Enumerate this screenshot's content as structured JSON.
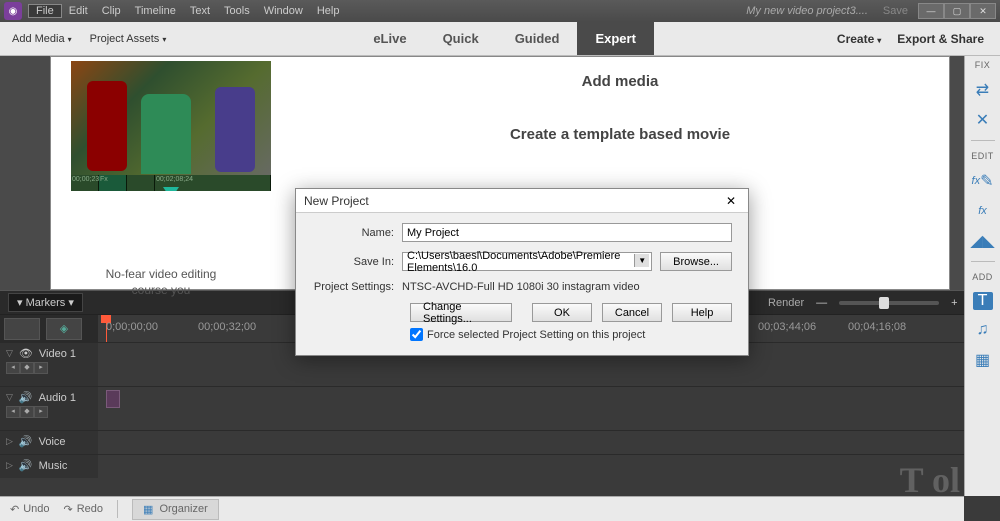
{
  "titlebar": {
    "menus": [
      "File",
      "Edit",
      "Clip",
      "Timeline",
      "Text",
      "Tools",
      "Window",
      "Help"
    ],
    "project_name": "My new video project3....",
    "save": "Save"
  },
  "toolbar": {
    "add_media": "Add Media",
    "project_assets": "Project Assets",
    "modes": {
      "elive": "eLive",
      "quick": "Quick",
      "guided": "Guided",
      "expert": "Expert"
    },
    "create": "Create",
    "export": "Export & Share"
  },
  "doc": {
    "add_media": "Add media",
    "template_movie": "Create a template based movie",
    "caption": "No-fear video editing course you"
  },
  "timeline": {
    "markers": "Markers",
    "render": "Render",
    "ticks": [
      "0;00;00;00",
      "00;00;32;00",
      "00;03;44;06",
      "00;04;16;08"
    ],
    "tracks": {
      "video1": "Video 1",
      "audio1": "Audio 1",
      "voice": "Voice",
      "music": "Music"
    }
  },
  "bottom": {
    "undo": "Undo",
    "redo": "Redo",
    "organizer": "Organizer"
  },
  "right": {
    "fix": "FIX",
    "edit": "EDIT",
    "add": "ADD"
  },
  "dialog": {
    "title": "New Project",
    "name_label": "Name:",
    "name_value": "My Project",
    "savein_label": "Save In:",
    "savein_value": "C:\\Users\\baesl\\Documents\\Adobe\\Premiere Elements\\16.0",
    "browse": "Browse...",
    "settings_label": "Project Settings:",
    "settings_value": "NTSC-AVCHD-Full HD 1080i 30 instagram video",
    "change": "Change Settings...",
    "ok": "OK",
    "cancel": "Cancel",
    "help": "Help",
    "force": "Force selected Project Setting on this project"
  },
  "watermark": "T ol"
}
